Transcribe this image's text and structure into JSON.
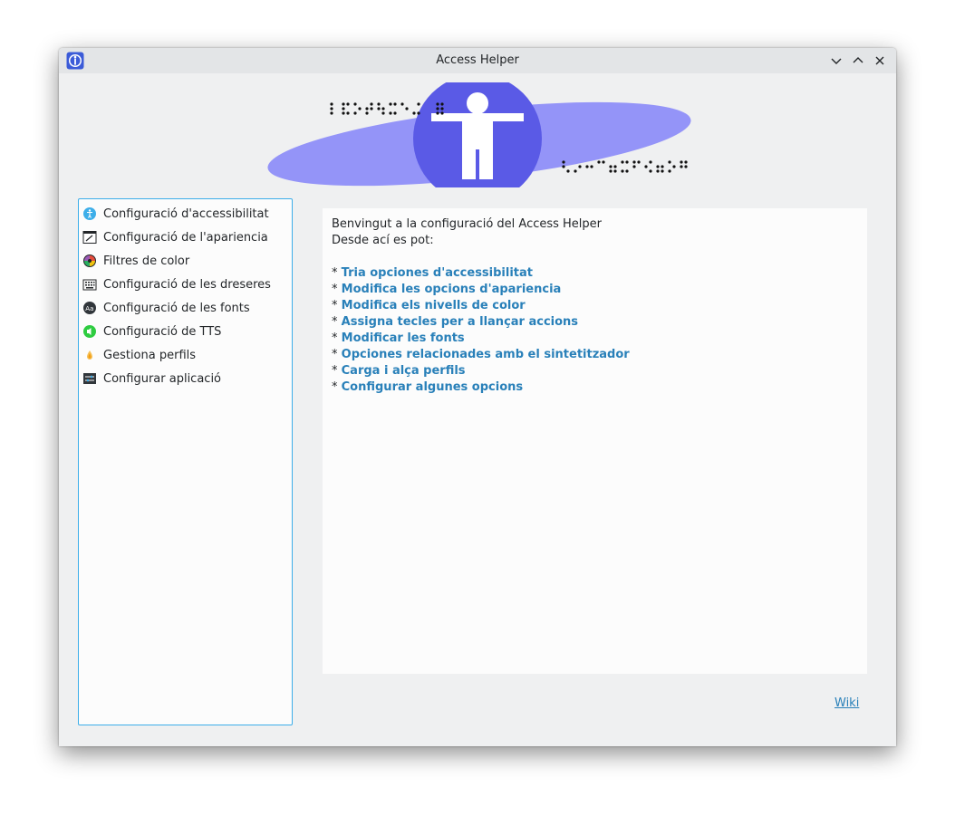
{
  "window": {
    "title": "Access Helper"
  },
  "titlebar_buttons": [
    {
      "name": "minimize-icon"
    },
    {
      "name": "maximize-icon"
    },
    {
      "name": "close-icon"
    }
  ],
  "banner": {
    "icon": "accessibility-person-icon",
    "decoration": "braille-dots"
  },
  "sidebar": {
    "items": [
      {
        "label": "Configuració d'accessibilitat",
        "icon": "accessibility-icon"
      },
      {
        "label": "Configuració de l'apariencia",
        "icon": "appearance-icon"
      },
      {
        "label": "Filtres de color",
        "icon": "color-filter-icon"
      },
      {
        "label": "Configuració de les dreseres",
        "icon": "keyboard-shortcuts-icon"
      },
      {
        "label": "Configuració de les fonts",
        "icon": "fonts-icon"
      },
      {
        "label": "Configuració de TTS",
        "icon": "tts-icon"
      },
      {
        "label": "Gestiona perfils",
        "icon": "profiles-icon"
      },
      {
        "label": "Configurar aplicació",
        "icon": "app-settings-icon"
      }
    ]
  },
  "content": {
    "intro_line1": "Benvingut a la configuració del Access Helper",
    "intro_line2": "Desde ací es pot:",
    "bullet": "*",
    "links": [
      "Tria opciones d'accessibilitat",
      "Modifica les opcions d'apariencia",
      "Modifica els nivells de color",
      "Assigna tecles per a llançar accions",
      "Modificar les fonts",
      "Opciones relacionades amb el sintetitzador",
      "Carga i alça perfils",
      "Configurar algunes opcions"
    ]
  },
  "footer": {
    "wiki_label": "Wiki"
  },
  "colors": {
    "accent": "#3daee9",
    "link": "#2980b9",
    "banner_ellipse": "#9494f8",
    "banner_circle": "#5a5ae6"
  }
}
